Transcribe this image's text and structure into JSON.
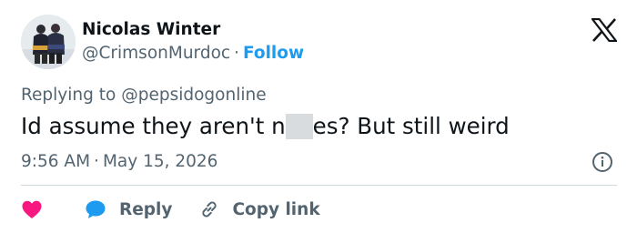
{
  "author": {
    "name": "Nicolas Winter",
    "handle": "@CrimsonMurdoc",
    "separator": "·",
    "follow_label": "Follow"
  },
  "reply": {
    "prefix": "Replying to",
    "mention": "@pepsidogonline"
  },
  "tweet": {
    "text_before": "Id assume they aren't n",
    "text_after": "es? But still weird"
  },
  "meta": {
    "time": "9:56 AM",
    "separator": "·",
    "date": "May 15, 2026"
  },
  "actions": {
    "reply_label": "Reply",
    "copy_link_label": "Copy link"
  },
  "icons": {
    "logo": "x-logo-icon",
    "info": "info-icon",
    "like": "heart-icon",
    "reply": "speech-bubble-icon",
    "copy": "link-icon"
  },
  "colors": {
    "accent": "#1d9bf0",
    "heart": "#f91880",
    "muted": "#536471",
    "text": "#0f1419"
  }
}
